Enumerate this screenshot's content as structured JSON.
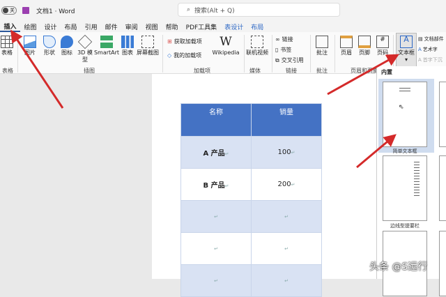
{
  "titlebar": {
    "autosave": "关",
    "doc_title": "文档1 · Word",
    "search_placeholder": "搜索(Alt + Q)"
  },
  "tabs": [
    "插入",
    "绘图",
    "设计",
    "布局",
    "引用",
    "邮件",
    "审阅",
    "视图",
    "帮助",
    "PDF工具集",
    "表设计",
    "布局"
  ],
  "ribbon": {
    "table": "表格",
    "pictures": "图片",
    "shapes": "形状",
    "icons": "图标",
    "model3d": "3D 模型",
    "smartart": "SmartArt",
    "chart": "图表",
    "screenshot": "屏幕截图",
    "get_addins": "获取加载项",
    "my_addins": "我的加载项",
    "wikipedia": "Wikipedia",
    "online_video": "联机视频",
    "link": "链接",
    "bookmark": "书签",
    "crossref": "交叉引用",
    "comment": "批注",
    "header": "页眉",
    "footer": "页脚",
    "pagenum": "页码",
    "textbox": "文本框",
    "quickparts": "文档部件",
    "wordart": "艺术字",
    "dropcap": "首字下沉",
    "groups": {
      "table": "表格",
      "illustrations": "插图",
      "addins": "加载项",
      "media": "媒体",
      "links": "链接",
      "comments": "批注",
      "headerfooter": "页眉和页脚"
    }
  },
  "table": {
    "headers": [
      "名称",
      "销量"
    ],
    "rows": [
      [
        "A 产品",
        "100"
      ],
      [
        "B 产品",
        "200"
      ],
      [
        "",
        ""
      ],
      [
        "",
        ""
      ],
      [
        "",
        ""
      ]
    ]
  },
  "panel": {
    "title": "内置",
    "items": [
      "简单文本框",
      "边线型提要栏"
    ]
  },
  "watermark": "头条 @S远行",
  "colors": {
    "header": "#4472c4",
    "band": "#d9e2f3",
    "arrow": "#d42a2a"
  }
}
